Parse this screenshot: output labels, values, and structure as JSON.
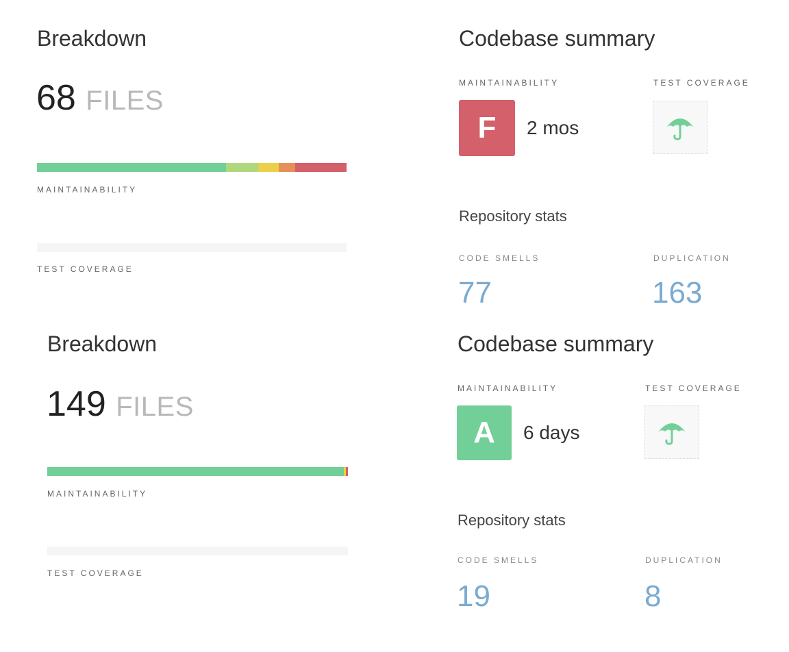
{
  "panels": [
    {
      "breakdown": {
        "title": "Breakdown",
        "files_count": "68",
        "files_unit": "FILES",
        "maintainability_label": "MAINTAINABILITY",
        "maintainability_distribution": [
          {
            "grade": "A",
            "percent": 61,
            "color": "#72cf98"
          },
          {
            "grade": "B",
            "percent": 10.5,
            "color": "#afd87c"
          },
          {
            "grade": "C",
            "percent": 6.5,
            "color": "#ecd04a"
          },
          {
            "grade": "D",
            "percent": 5.5,
            "color": "#e49159"
          },
          {
            "grade": "F",
            "percent": 16.5,
            "color": "#d3606b"
          }
        ],
        "test_coverage_label": "TEST COVERAGE"
      },
      "summary": {
        "title": "Codebase summary",
        "maintainability_label": "MAINTAINABILITY",
        "grade": "F",
        "grade_color": "#d3606b",
        "grade_time": "2 mos",
        "test_coverage_label": "TEST COVERAGE",
        "coverage_icon": "umbrella-icon",
        "repo_stats_title": "Repository stats",
        "code_smells_label": "CODE SMELLS",
        "code_smells_value": "77",
        "duplication_label": "DUPLICATION",
        "duplication_value": "163"
      }
    },
    {
      "breakdown": {
        "title": "Breakdown",
        "files_count": "149",
        "files_unit": "FILES",
        "maintainability_label": "MAINTAINABILITY",
        "maintainability_distribution": [
          {
            "grade": "A",
            "percent": 98.6,
            "color": "#72cf98"
          },
          {
            "grade": "C",
            "percent": 0.8,
            "color": "#ecd04a"
          },
          {
            "grade": "F",
            "percent": 0.6,
            "color": "#d3606b"
          }
        ],
        "test_coverage_label": "TEST COVERAGE"
      },
      "summary": {
        "title": "Codebase summary",
        "maintainability_label": "MAINTAINABILITY",
        "grade": "A",
        "grade_color": "#72cf98",
        "grade_time": "6 days",
        "test_coverage_label": "TEST COVERAGE",
        "coverage_icon": "umbrella-icon",
        "repo_stats_title": "Repository stats",
        "code_smells_label": "CODE SMELLS",
        "code_smells_value": "19",
        "duplication_label": "DUPLICATION",
        "duplication_value": "8"
      }
    }
  ],
  "umbrella_color": "#72cf98"
}
